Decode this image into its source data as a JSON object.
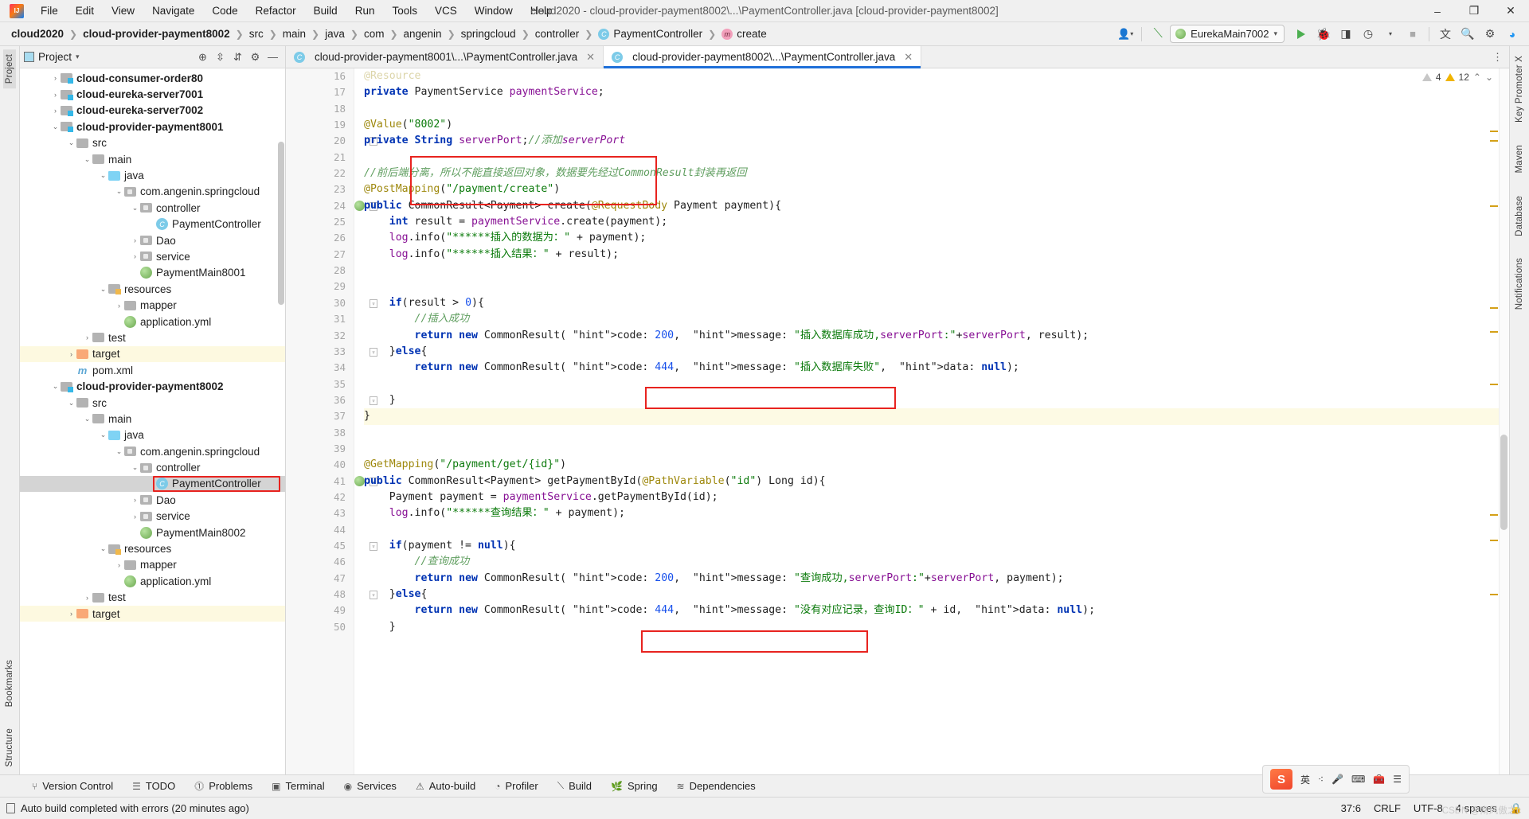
{
  "window": {
    "title": "cloud2020 - cloud-provider-payment8002\\...\\PaymentController.java [cloud-provider-payment8002]",
    "minimize": "–",
    "maximize": "❐",
    "close": "✕"
  },
  "menubar": {
    "items": [
      "File",
      "Edit",
      "View",
      "Navigate",
      "Code",
      "Refactor",
      "Build",
      "Run",
      "Tools",
      "VCS",
      "Window",
      "Help"
    ]
  },
  "breadcrumb": {
    "items": [
      {
        "label": "cloud2020",
        "bold": true,
        "icon": ""
      },
      {
        "label": "cloud-provider-payment8002",
        "bold": true,
        "icon": ""
      },
      {
        "label": "src",
        "bold": false,
        "icon": ""
      },
      {
        "label": "main",
        "bold": false,
        "icon": ""
      },
      {
        "label": "java",
        "bold": false,
        "icon": ""
      },
      {
        "label": "com",
        "bold": false,
        "icon": ""
      },
      {
        "label": "angenin",
        "bold": false,
        "icon": ""
      },
      {
        "label": "springcloud",
        "bold": false,
        "icon": ""
      },
      {
        "label": "controller",
        "bold": false,
        "icon": ""
      },
      {
        "label": "PaymentController",
        "bold": false,
        "icon": "class-icon"
      },
      {
        "label": "create",
        "bold": false,
        "icon": "method-icon"
      }
    ]
  },
  "toolbar": {
    "run_config": "EurekaMain7002",
    "dropdown_caret": "▾",
    "icons": [
      "user-icon",
      "hammer-icon",
      "run-icon",
      "debug-icon",
      "run-coverage-icon",
      "profile-icon",
      "stop-icon",
      "translate-icon",
      "search-icon",
      "settings-icon",
      "updates-icon"
    ]
  },
  "project_panel": {
    "title": "Project",
    "caret": "▾",
    "header_icons": [
      "locate-icon",
      "expand-all-icon",
      "collapse-all-icon",
      "settings-icon",
      "hide-icon"
    ],
    "tree": [
      {
        "label": "cloud-consumer-order80",
        "depth": 1,
        "arrow": "›",
        "icon": "module-folder",
        "bold": true
      },
      {
        "label": "cloud-eureka-server7001",
        "depth": 1,
        "arrow": "›",
        "icon": "module-folder",
        "bold": true
      },
      {
        "label": "cloud-eureka-server7002",
        "depth": 1,
        "arrow": "›",
        "icon": "module-folder",
        "bold": true
      },
      {
        "label": "cloud-provider-payment8001",
        "depth": 1,
        "arrow": "⌄",
        "icon": "module-folder",
        "bold": true
      },
      {
        "label": "src",
        "depth": 2,
        "arrow": "⌄",
        "icon": "folder",
        "bold": false
      },
      {
        "label": "main",
        "depth": 3,
        "arrow": "⌄",
        "icon": "folder",
        "bold": false
      },
      {
        "label": "java",
        "depth": 4,
        "arrow": "⌄",
        "icon": "source-folder",
        "bold": false
      },
      {
        "label": "com.angenin.springcloud",
        "depth": 5,
        "arrow": "⌄",
        "icon": "package",
        "bold": false
      },
      {
        "label": "controller",
        "depth": 6,
        "arrow": "⌄",
        "icon": "package",
        "bold": false
      },
      {
        "label": "PaymentController",
        "depth": 7,
        "arrow": "",
        "icon": "class",
        "bold": false
      },
      {
        "label": "Dao",
        "depth": 6,
        "arrow": "›",
        "icon": "package",
        "bold": false
      },
      {
        "label": "service",
        "depth": 6,
        "arrow": "›",
        "icon": "package",
        "bold": false
      },
      {
        "label": "PaymentMain8001",
        "depth": 6,
        "arrow": "",
        "icon": "spring-class",
        "bold": false
      },
      {
        "label": "resources",
        "depth": 4,
        "arrow": "⌄",
        "icon": "resource-folder",
        "bold": false
      },
      {
        "label": "mapper",
        "depth": 5,
        "arrow": "›",
        "icon": "folder",
        "bold": false
      },
      {
        "label": "application.yml",
        "depth": 5,
        "arrow": "",
        "icon": "spring-yml",
        "bold": false
      },
      {
        "label": "test",
        "depth": 3,
        "arrow": "›",
        "icon": "folder",
        "bold": false
      },
      {
        "label": "target",
        "depth": 2,
        "arrow": "›",
        "icon": "target-folder",
        "bold": false,
        "highlight": true
      },
      {
        "label": "pom.xml",
        "depth": 2,
        "arrow": "",
        "icon": "maven",
        "bold": false
      },
      {
        "label": "cloud-provider-payment8002",
        "depth": 1,
        "arrow": "⌄",
        "icon": "module-folder",
        "bold": true
      },
      {
        "label": "src",
        "depth": 2,
        "arrow": "⌄",
        "icon": "folder",
        "bold": false
      },
      {
        "label": "main",
        "depth": 3,
        "arrow": "⌄",
        "icon": "folder",
        "bold": false
      },
      {
        "label": "java",
        "depth": 4,
        "arrow": "⌄",
        "icon": "source-folder",
        "bold": false
      },
      {
        "label": "com.angenin.springcloud",
        "depth": 5,
        "arrow": "⌄",
        "icon": "package",
        "bold": false
      },
      {
        "label": "controller",
        "depth": 6,
        "arrow": "⌄",
        "icon": "package",
        "bold": false
      },
      {
        "label": "PaymentController",
        "depth": 7,
        "arrow": "",
        "icon": "class",
        "bold": false,
        "selected": true,
        "boxed": true
      },
      {
        "label": "Dao",
        "depth": 6,
        "arrow": "›",
        "icon": "package",
        "bold": false
      },
      {
        "label": "service",
        "depth": 6,
        "arrow": "›",
        "icon": "package",
        "bold": false
      },
      {
        "label": "PaymentMain8002",
        "depth": 6,
        "arrow": "",
        "icon": "spring-class",
        "bold": false
      },
      {
        "label": "resources",
        "depth": 4,
        "arrow": "⌄",
        "icon": "resource-folder",
        "bold": false
      },
      {
        "label": "mapper",
        "depth": 5,
        "arrow": "›",
        "icon": "folder",
        "bold": false
      },
      {
        "label": "application.yml",
        "depth": 5,
        "arrow": "",
        "icon": "spring-yml",
        "bold": false
      },
      {
        "label": "test",
        "depth": 3,
        "arrow": "›",
        "icon": "folder",
        "bold": false
      },
      {
        "label": "target",
        "depth": 2,
        "arrow": "›",
        "icon": "target-folder",
        "bold": false,
        "highlight": true
      }
    ]
  },
  "left_rail": {
    "top": [
      "Project"
    ],
    "bottom": [
      "Bookmarks",
      "Structure"
    ]
  },
  "right_rail": {
    "items": [
      "Key Promoter X",
      "Maven",
      "Database",
      "Notifications"
    ]
  },
  "editor": {
    "tabs": [
      {
        "label": "cloud-provider-payment8001\\...\\PaymentController.java",
        "active": false,
        "icon": "class-icon",
        "close": "✕"
      },
      {
        "label": "cloud-provider-payment8002\\...\\PaymentController.java",
        "active": true,
        "icon": "class-icon",
        "close": "✕"
      }
    ],
    "inspection": {
      "error_count": "4",
      "warning_count": "12",
      "caret_down": "⌄",
      "chevron": "⌃"
    },
    "lines": [
      {
        "n": "16",
        "text": "@Resource",
        "partial": true
      },
      {
        "n": "17",
        "text": "private PaymentService paymentService;"
      },
      {
        "n": "18",
        "text": ""
      },
      {
        "n": "19",
        "text": "@Value(\"8002\")"
      },
      {
        "n": "20",
        "text": "private String serverPort;//添加serverPort"
      },
      {
        "n": "21",
        "text": ""
      },
      {
        "n": "22",
        "text": "//前后端分离，所以不能直接返回对象，数据要先经过CommonResult封装再返回"
      },
      {
        "n": "23",
        "text": "@PostMapping(\"/payment/create\")"
      },
      {
        "n": "24",
        "text": "public CommonResult<Payment> create(@RequestBody Payment payment){"
      },
      {
        "n": "25",
        "text": "    int result = paymentService.create(payment);"
      },
      {
        "n": "26",
        "text": "    log.info(\"******插入的数据为：\" + payment);"
      },
      {
        "n": "27",
        "text": "    log.info(\"******插入结果：\" + result);"
      },
      {
        "n": "28",
        "text": ""
      },
      {
        "n": "29",
        "text": ""
      },
      {
        "n": "30",
        "text": "    if(result > 0){"
      },
      {
        "n": "31",
        "text": "        //插入成功"
      },
      {
        "n": "32",
        "text": "        return new CommonResult( code: 200,  message: \"插入数据库成功,serverPort:\"+serverPort, result);"
      },
      {
        "n": "33",
        "text": "    }else{"
      },
      {
        "n": "34",
        "text": "        return new CommonResult( code: 444,  message: \"插入数据库失败\",  data: null);"
      },
      {
        "n": "35",
        "text": ""
      },
      {
        "n": "36",
        "text": "    }"
      },
      {
        "n": "37",
        "text": "}"
      },
      {
        "n": "38",
        "text": ""
      },
      {
        "n": "39",
        "text": ""
      },
      {
        "n": "40",
        "text": "@GetMapping(\"/payment/get/{id}\")"
      },
      {
        "n": "41",
        "text": "public CommonResult<Payment> getPaymentById(@PathVariable(\"id\") Long id){"
      },
      {
        "n": "42",
        "text": "    Payment payment = paymentService.getPaymentById(id);"
      },
      {
        "n": "43",
        "text": "    log.info(\"******查询结果：\" + payment);"
      },
      {
        "n": "44",
        "text": ""
      },
      {
        "n": "45",
        "text": "    if(payment != null){"
      },
      {
        "n": "46",
        "text": "        //查询成功"
      },
      {
        "n": "47",
        "text": "        return new CommonResult( code: 200,  message: \"查询成功,serverPort:\"+serverPort, payment);"
      },
      {
        "n": "48",
        "text": "    }else{"
      },
      {
        "n": "49",
        "text": "        return new CommonResult( code: 444,  message: \"没有对应记录，查询ID：\" + id,  data: null);"
      },
      {
        "n": "50",
        "text": "    }"
      }
    ]
  },
  "bottom_tools": {
    "items": [
      {
        "label": "Version Control",
        "icon": "branch-icon"
      },
      {
        "label": "TODO",
        "icon": "list-icon"
      },
      {
        "label": "Problems",
        "icon": "warning-circle-icon"
      },
      {
        "label": "Terminal",
        "icon": "terminal-icon"
      },
      {
        "label": "Services",
        "icon": "services-icon"
      },
      {
        "label": "Auto-build",
        "icon": "triangle-icon"
      },
      {
        "label": "Profiler",
        "icon": "profiler-icon"
      },
      {
        "label": "Build",
        "icon": "hammer-icon"
      },
      {
        "label": "Spring",
        "icon": "leaf-icon"
      },
      {
        "label": "Dependencies",
        "icon": "stack-icon"
      }
    ]
  },
  "statusbar": {
    "message": "Auto build completed with errors (20 minutes ago)",
    "caret_position": "37:6",
    "line_separator": "CRLF",
    "encoding": "UTF-8",
    "indent": "4 spaces",
    "lock_icon": "🔒"
  },
  "ime": {
    "logo": "S",
    "mode": "英",
    "icons": [
      "dots-icon",
      "mic-icon",
      "keyboard-icon",
      "toolbox-icon",
      "menu-icon"
    ]
  },
  "colors": {
    "accent": "#3e8fd6",
    "redbox": "#e8231f",
    "selection": "#d4d4d4",
    "highlight_row": "#fdf9e0",
    "keyword": "#0033b3",
    "string": "#0b7a0b",
    "annotation": "#9e880d",
    "comment": "#8c8c8c",
    "field": "#871094"
  }
}
